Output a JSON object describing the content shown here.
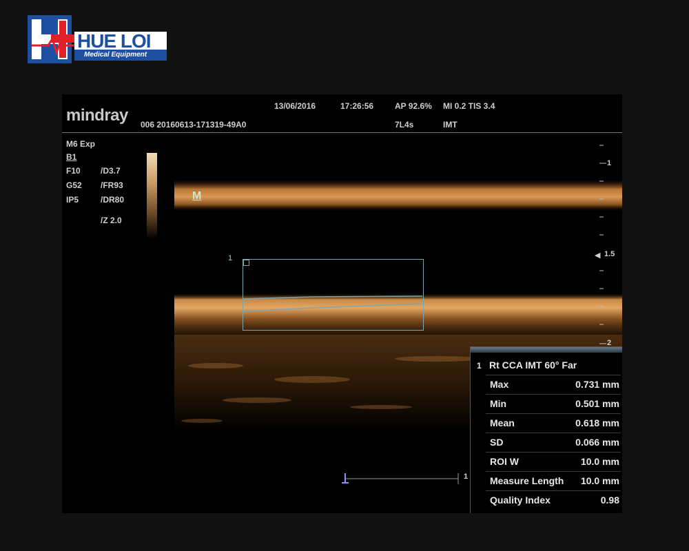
{
  "watermark": {
    "brand_text": "HUE LOI",
    "tagline": "Medical Equipment",
    "colors": {
      "red": "#e3202a",
      "blue": "#1e4fa0"
    }
  },
  "header": {
    "manufacturer": "mindray",
    "patient_id": "006 20160613-171319-49A0",
    "date": "13/06/2016",
    "time": "17:26:56",
    "acoustic_power": "AP 92.6%",
    "indices": "MI 0.2 TIS 3.4",
    "probe": "7L4s",
    "exam_mode": "IMT"
  },
  "imaging_params": {
    "preset": "M6 Exp",
    "mode": "B1",
    "frequency": "F10",
    "depth": "/D3.7",
    "gain": "G52",
    "frame_rate": "/FR93",
    "image_process": "IP5",
    "dynamic_range": "/DR80",
    "zoom": "/Z 2.0"
  },
  "image": {
    "marker": "M",
    "roi_number": "1",
    "colors": {
      "tissue": "#c8823c",
      "roi": "#7fa6ad"
    }
  },
  "depth_scale": {
    "labels": [
      "1",
      "1.5",
      "2"
    ]
  },
  "scale_bar": {
    "label": "1"
  },
  "measurement": {
    "index": "1",
    "title": "Rt CCA IMT 60° Far",
    "rows": [
      {
        "label": "Max",
        "value": "0.731 mm"
      },
      {
        "label": "Min",
        "value": "0.501 mm"
      },
      {
        "label": "Mean",
        "value": "0.618 mm"
      },
      {
        "label": "SD",
        "value": "0.066 mm"
      },
      {
        "label": "ROI W",
        "value": "10.0 mm"
      },
      {
        "label": "Measure Length",
        "value": "10.0 mm"
      },
      {
        "label": "Quality Index",
        "value": "0.98"
      }
    ]
  }
}
